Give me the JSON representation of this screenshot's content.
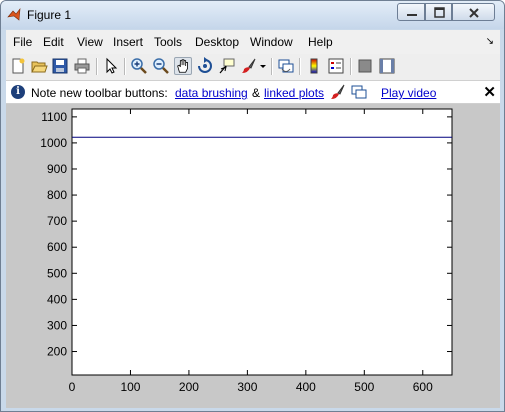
{
  "window": {
    "title": "Figure 1"
  },
  "menubar": {
    "items": [
      "File",
      "Edit",
      "View",
      "Insert",
      "Tools",
      "Desktop",
      "Window",
      "Help"
    ],
    "grip": "↘"
  },
  "toolbar": {
    "buttons": [
      {
        "icon": "new-figure-icon"
      },
      {
        "icon": "open-file-icon"
      },
      {
        "icon": "save-figure-icon"
      },
      {
        "icon": "print-figure-icon"
      },
      {
        "icon": "edit-plot-arrow-icon"
      },
      {
        "icon": "zoom-in-icon"
      },
      {
        "icon": "zoom-out-icon"
      },
      {
        "icon": "pan-hand-icon",
        "pressed": true
      },
      {
        "icon": "rotate-3d-icon"
      },
      {
        "icon": "data-cursor-icon"
      },
      {
        "icon": "brush-icon"
      },
      {
        "icon": "brush-dropdown-icon"
      },
      {
        "icon": "link-plot-icon"
      },
      {
        "icon": "insert-colorbar-icon"
      },
      {
        "icon": "insert-legend-icon"
      },
      {
        "icon": "hide-plot-tools-icon"
      },
      {
        "icon": "show-plot-tools-icon"
      }
    ]
  },
  "infobar": {
    "note": "Note new toolbar buttons:",
    "link_brushing": "data brushing",
    "ampersand": "&",
    "link_linked": "linked plots",
    "link_video": "Play video",
    "close_label": "✕"
  },
  "chart_data": {
    "type": "line",
    "title": "",
    "xlabel": "",
    "ylabel": "",
    "xlim": [
      0,
      650
    ],
    "ylim": [
      110,
      1130
    ],
    "xticks": [
      0,
      100,
      200,
      300,
      400,
      500,
      600
    ],
    "yticks": [
      200,
      300,
      400,
      500,
      600,
      700,
      800,
      900,
      1000,
      1100
    ],
    "grid": false,
    "series": [
      {
        "x": [
          0,
          650
        ],
        "y": [
          1022,
          1022
        ],
        "color": "#00007f"
      }
    ]
  }
}
